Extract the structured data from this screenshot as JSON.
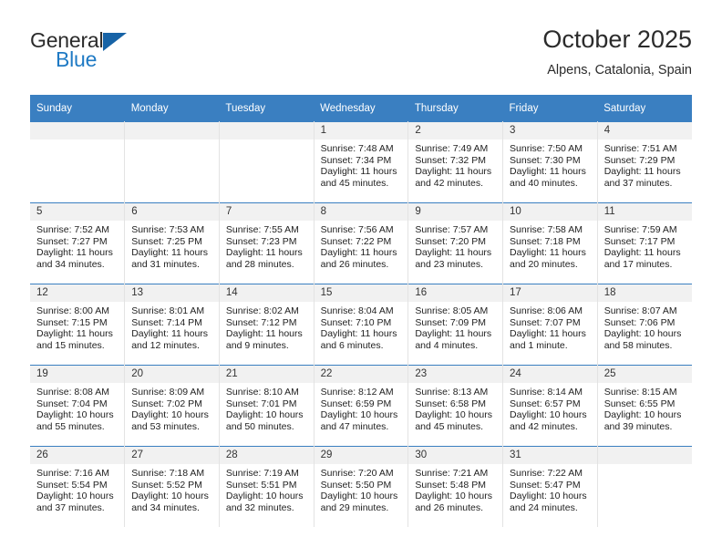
{
  "brand": {
    "name_part1": "General",
    "name_part2": "Blue",
    "triangle_color": "#1763a6",
    "blue_color": "#1f7ac4"
  },
  "header": {
    "title": "October 2025",
    "subtitle": "Alpens, Catalonia, Spain"
  },
  "colors": {
    "header_blue": "#3a7fc1",
    "day_band_gray": "#f1f1f1",
    "cell_white": "#ffffff"
  },
  "calendar": {
    "weekday_headers": [
      "Sunday",
      "Monday",
      "Tuesday",
      "Wednesday",
      "Thursday",
      "Friday",
      "Saturday"
    ],
    "weeks": [
      [
        {
          "day": "",
          "sunrise": "",
          "sunset": "",
          "daylight": ""
        },
        {
          "day": "",
          "sunrise": "",
          "sunset": "",
          "daylight": ""
        },
        {
          "day": "",
          "sunrise": "",
          "sunset": "",
          "daylight": ""
        },
        {
          "day": "1",
          "sunrise": "Sunrise: 7:48 AM",
          "sunset": "Sunset: 7:34 PM",
          "daylight": "Daylight: 11 hours and 45 minutes."
        },
        {
          "day": "2",
          "sunrise": "Sunrise: 7:49 AM",
          "sunset": "Sunset: 7:32 PM",
          "daylight": "Daylight: 11 hours and 42 minutes."
        },
        {
          "day": "3",
          "sunrise": "Sunrise: 7:50 AM",
          "sunset": "Sunset: 7:30 PM",
          "daylight": "Daylight: 11 hours and 40 minutes."
        },
        {
          "day": "4",
          "sunrise": "Sunrise: 7:51 AM",
          "sunset": "Sunset: 7:29 PM",
          "daylight": "Daylight: 11 hours and 37 minutes."
        }
      ],
      [
        {
          "day": "5",
          "sunrise": "Sunrise: 7:52 AM",
          "sunset": "Sunset: 7:27 PM",
          "daylight": "Daylight: 11 hours and 34 minutes."
        },
        {
          "day": "6",
          "sunrise": "Sunrise: 7:53 AM",
          "sunset": "Sunset: 7:25 PM",
          "daylight": "Daylight: 11 hours and 31 minutes."
        },
        {
          "day": "7",
          "sunrise": "Sunrise: 7:55 AM",
          "sunset": "Sunset: 7:23 PM",
          "daylight": "Daylight: 11 hours and 28 minutes."
        },
        {
          "day": "8",
          "sunrise": "Sunrise: 7:56 AM",
          "sunset": "Sunset: 7:22 PM",
          "daylight": "Daylight: 11 hours and 26 minutes."
        },
        {
          "day": "9",
          "sunrise": "Sunrise: 7:57 AM",
          "sunset": "Sunset: 7:20 PM",
          "daylight": "Daylight: 11 hours and 23 minutes."
        },
        {
          "day": "10",
          "sunrise": "Sunrise: 7:58 AM",
          "sunset": "Sunset: 7:18 PM",
          "daylight": "Daylight: 11 hours and 20 minutes."
        },
        {
          "day": "11",
          "sunrise": "Sunrise: 7:59 AM",
          "sunset": "Sunset: 7:17 PM",
          "daylight": "Daylight: 11 hours and 17 minutes."
        }
      ],
      [
        {
          "day": "12",
          "sunrise": "Sunrise: 8:00 AM",
          "sunset": "Sunset: 7:15 PM",
          "daylight": "Daylight: 11 hours and 15 minutes."
        },
        {
          "day": "13",
          "sunrise": "Sunrise: 8:01 AM",
          "sunset": "Sunset: 7:14 PM",
          "daylight": "Daylight: 11 hours and 12 minutes."
        },
        {
          "day": "14",
          "sunrise": "Sunrise: 8:02 AM",
          "sunset": "Sunset: 7:12 PM",
          "daylight": "Daylight: 11 hours and 9 minutes."
        },
        {
          "day": "15",
          "sunrise": "Sunrise: 8:04 AM",
          "sunset": "Sunset: 7:10 PM",
          "daylight": "Daylight: 11 hours and 6 minutes."
        },
        {
          "day": "16",
          "sunrise": "Sunrise: 8:05 AM",
          "sunset": "Sunset: 7:09 PM",
          "daylight": "Daylight: 11 hours and 4 minutes."
        },
        {
          "day": "17",
          "sunrise": "Sunrise: 8:06 AM",
          "sunset": "Sunset: 7:07 PM",
          "daylight": "Daylight: 11 hours and 1 minute."
        },
        {
          "day": "18",
          "sunrise": "Sunrise: 8:07 AM",
          "sunset": "Sunset: 7:06 PM",
          "daylight": "Daylight: 10 hours and 58 minutes."
        }
      ],
      [
        {
          "day": "19",
          "sunrise": "Sunrise: 8:08 AM",
          "sunset": "Sunset: 7:04 PM",
          "daylight": "Daylight: 10 hours and 55 minutes."
        },
        {
          "day": "20",
          "sunrise": "Sunrise: 8:09 AM",
          "sunset": "Sunset: 7:02 PM",
          "daylight": "Daylight: 10 hours and 53 minutes."
        },
        {
          "day": "21",
          "sunrise": "Sunrise: 8:10 AM",
          "sunset": "Sunset: 7:01 PM",
          "daylight": "Daylight: 10 hours and 50 minutes."
        },
        {
          "day": "22",
          "sunrise": "Sunrise: 8:12 AM",
          "sunset": "Sunset: 6:59 PM",
          "daylight": "Daylight: 10 hours and 47 minutes."
        },
        {
          "day": "23",
          "sunrise": "Sunrise: 8:13 AM",
          "sunset": "Sunset: 6:58 PM",
          "daylight": "Daylight: 10 hours and 45 minutes."
        },
        {
          "day": "24",
          "sunrise": "Sunrise: 8:14 AM",
          "sunset": "Sunset: 6:57 PM",
          "daylight": "Daylight: 10 hours and 42 minutes."
        },
        {
          "day": "25",
          "sunrise": "Sunrise: 8:15 AM",
          "sunset": "Sunset: 6:55 PM",
          "daylight": "Daylight: 10 hours and 39 minutes."
        }
      ],
      [
        {
          "day": "26",
          "sunrise": "Sunrise: 7:16 AM",
          "sunset": "Sunset: 5:54 PM",
          "daylight": "Daylight: 10 hours and 37 minutes."
        },
        {
          "day": "27",
          "sunrise": "Sunrise: 7:18 AM",
          "sunset": "Sunset: 5:52 PM",
          "daylight": "Daylight: 10 hours and 34 minutes."
        },
        {
          "day": "28",
          "sunrise": "Sunrise: 7:19 AM",
          "sunset": "Sunset: 5:51 PM",
          "daylight": "Daylight: 10 hours and 32 minutes."
        },
        {
          "day": "29",
          "sunrise": "Sunrise: 7:20 AM",
          "sunset": "Sunset: 5:50 PM",
          "daylight": "Daylight: 10 hours and 29 minutes."
        },
        {
          "day": "30",
          "sunrise": "Sunrise: 7:21 AM",
          "sunset": "Sunset: 5:48 PM",
          "daylight": "Daylight: 10 hours and 26 minutes."
        },
        {
          "day": "31",
          "sunrise": "Sunrise: 7:22 AM",
          "sunset": "Sunset: 5:47 PM",
          "daylight": "Daylight: 10 hours and 24 minutes."
        },
        {
          "day": "",
          "sunrise": "",
          "sunset": "",
          "daylight": ""
        }
      ]
    ]
  }
}
